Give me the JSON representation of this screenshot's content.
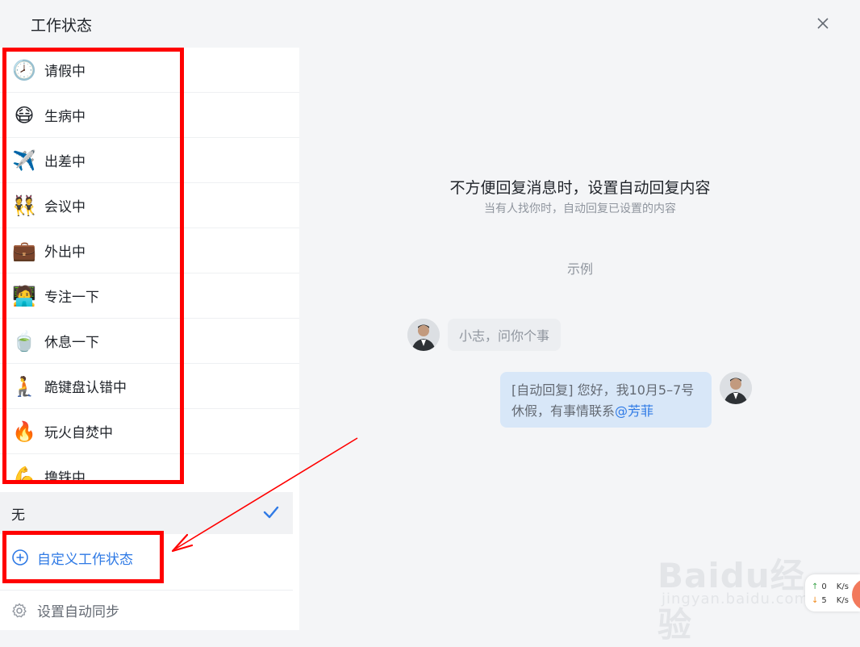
{
  "window": {
    "title": "工作状态"
  },
  "statuses": [
    {
      "emoji": "🕗",
      "icon": "clock-icon",
      "label": "请假中"
    },
    {
      "emoji": "😷",
      "icon": "mask-face-icon",
      "label": "生病中"
    },
    {
      "emoji": "✈️",
      "icon": "airplane-icon",
      "label": "出差中"
    },
    {
      "emoji": "👯",
      "icon": "meeting-people-icon",
      "label": "会议中"
    },
    {
      "emoji": "💼",
      "icon": "briefcase-icon",
      "label": "外出中"
    },
    {
      "emoji": "🧑‍💻",
      "icon": "laptop-person-icon",
      "label": "专注一下"
    },
    {
      "emoji": "🍵",
      "icon": "tea-icon",
      "label": "休息一下"
    },
    {
      "emoji": "🧎",
      "icon": "kneeling-person-icon",
      "label": "跪键盘认错中"
    },
    {
      "emoji": "🔥",
      "icon": "fire-icon",
      "label": "玩火自焚中"
    },
    {
      "emoji": "💪",
      "icon": "flexed-biceps-icon",
      "label": "撸铁中"
    }
  ],
  "none_option": {
    "label": "无",
    "selected": true
  },
  "custom": {
    "label": "自定义工作状态"
  },
  "sync": {
    "label": "设置自动同步"
  },
  "main": {
    "title": "不方便回复消息时，设置自动回复内容",
    "subtitle": "当有人找你时，自动回复已设置的内容",
    "example_label": "示例",
    "incoming_message": "小志，问你个事",
    "reply_line1": "[自动回复] 您好，我10月5–7号",
    "reply_line2": "休假，有事情联系",
    "reply_mention": "@芳菲"
  },
  "watermark": {
    "brand": "Baidu经验",
    "url": "jingyan.baidu.com"
  },
  "net_speed": {
    "up": "0",
    "down": "5",
    "unit": "K/s"
  },
  "colors": {
    "accent": "#2f7ae5",
    "annotation": "#ff0000",
    "sidebar_bg": "#ffffff",
    "panel_bg": "#f4f5f7",
    "reply_bubble": "#d8e7f8"
  }
}
